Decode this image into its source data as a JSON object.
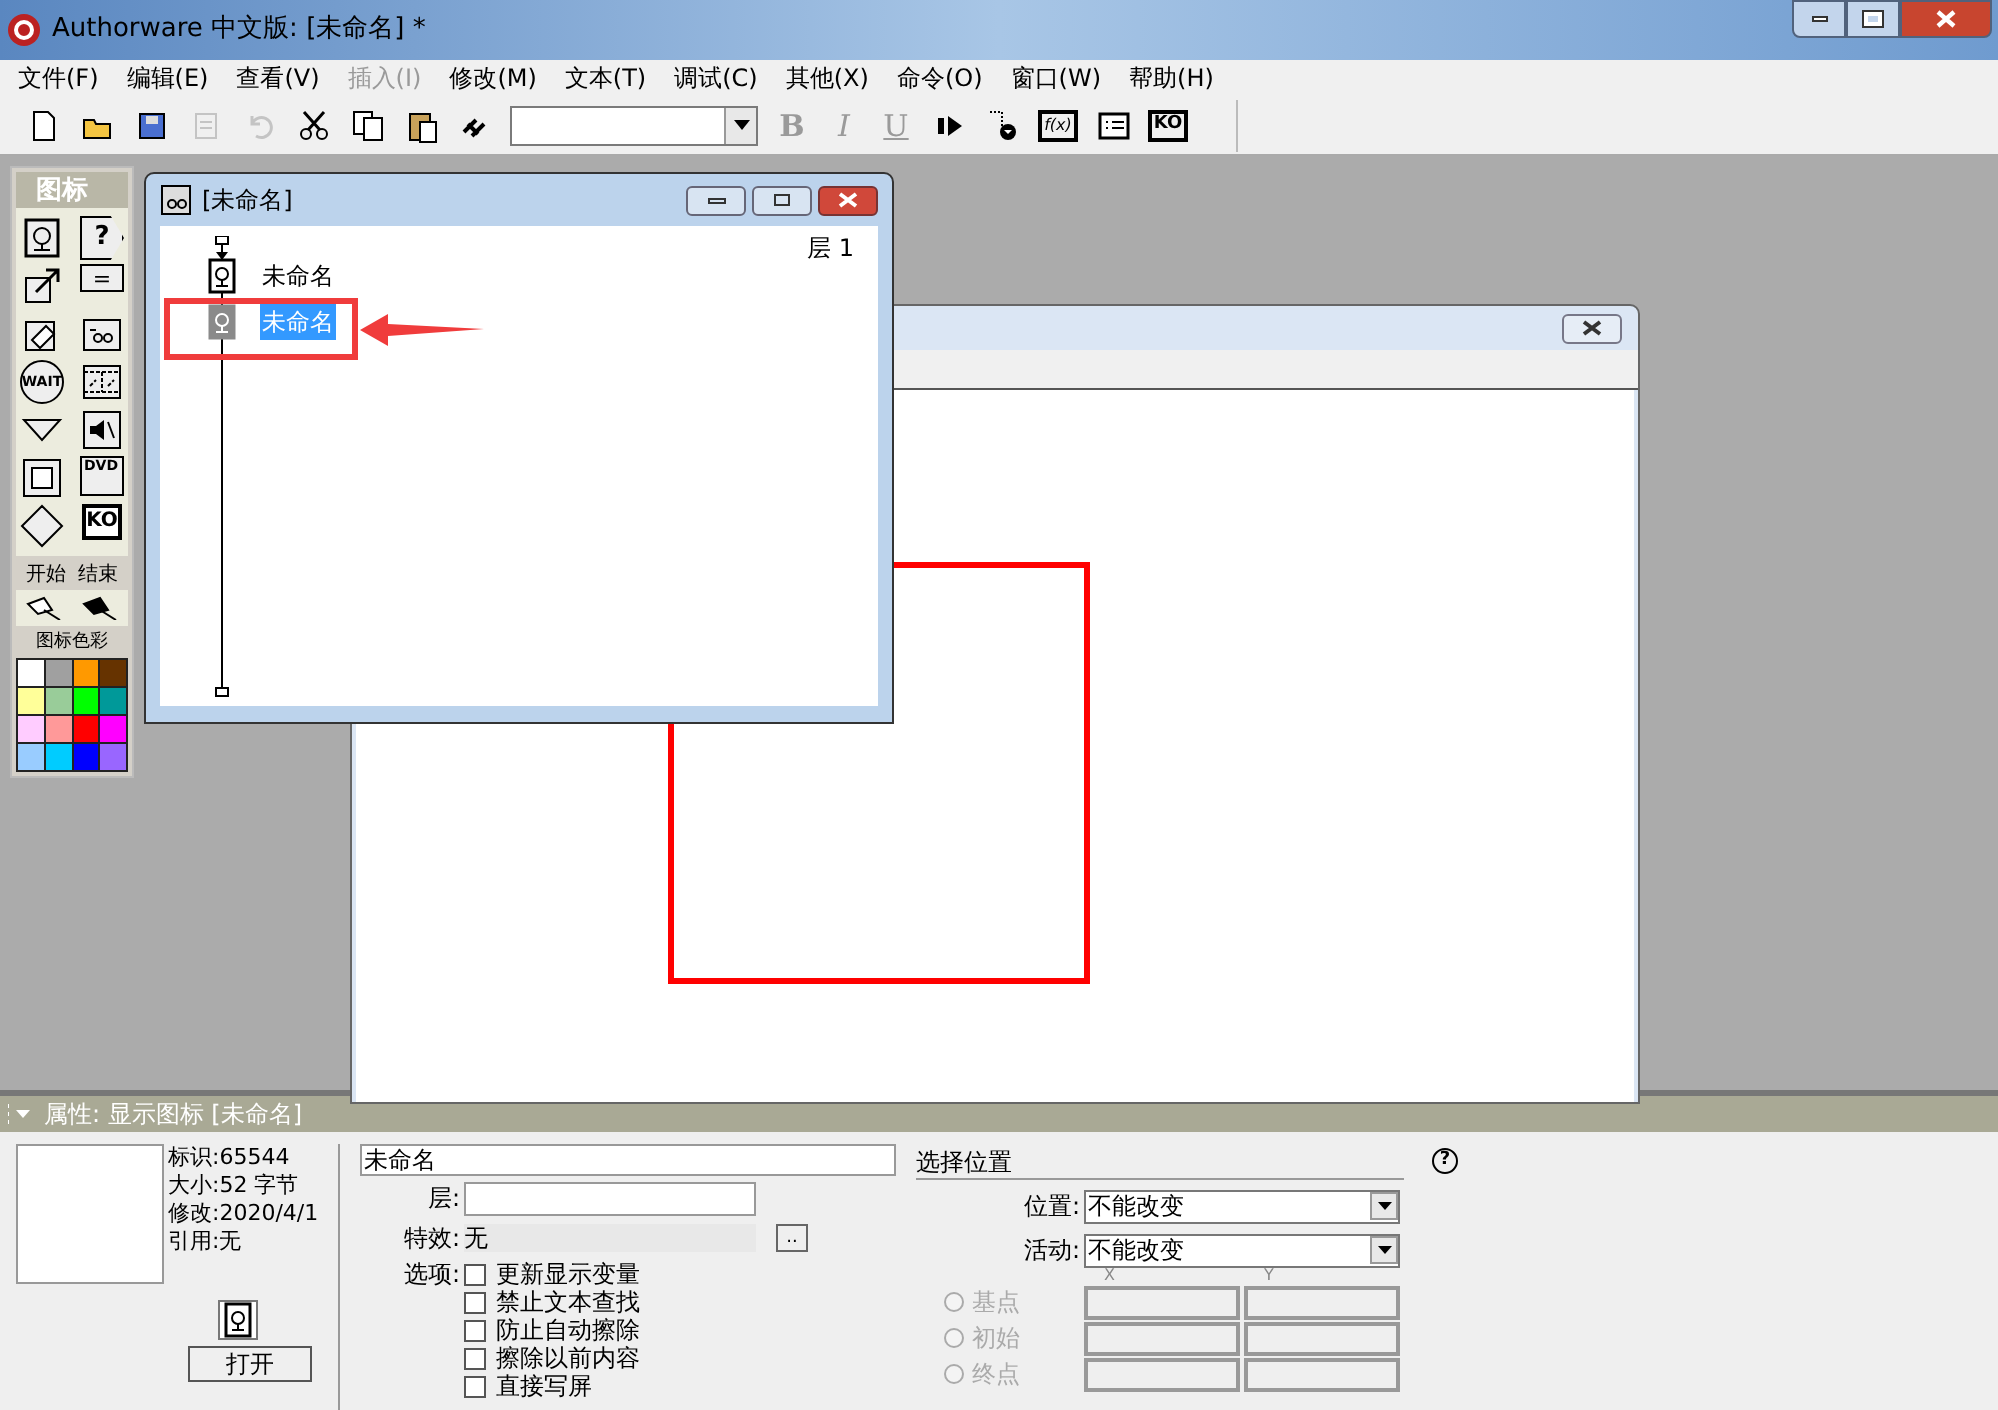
{
  "window": {
    "title": "Authorware 中文版: [未命名] *"
  },
  "menu": [
    {
      "label": "文件(F)",
      "disabled": false
    },
    {
      "label": "编辑(E)",
      "disabled": false
    },
    {
      "label": "查看(V)",
      "disabled": false
    },
    {
      "label": "插入(I)",
      "disabled": true
    },
    {
      "label": "修改(M)",
      "disabled": false
    },
    {
      "label": "文本(T)",
      "disabled": false
    },
    {
      "label": "调试(C)",
      "disabled": false
    },
    {
      "label": "其他(X)",
      "disabled": false
    },
    {
      "label": "命令(O)",
      "disabled": false
    },
    {
      "label": "窗口(W)",
      "disabled": false
    },
    {
      "label": "帮助(H)",
      "disabled": false
    }
  ],
  "toolbar": [
    {
      "kind": "new",
      "disabled": false
    },
    {
      "kind": "open",
      "disabled": false
    },
    {
      "kind": "save",
      "disabled": false
    },
    {
      "kind": "import",
      "disabled": true
    },
    {
      "kind": "undo",
      "disabled": true
    },
    {
      "kind": "cut",
      "disabled": false
    },
    {
      "kind": "copy",
      "disabled": false
    },
    {
      "kind": "paste",
      "disabled": false
    },
    {
      "kind": "find",
      "disabled": false
    },
    {
      "kind": "dropdown",
      "disabled": false
    },
    {
      "kind": "bold",
      "label": "B",
      "disabled": true
    },
    {
      "kind": "italic",
      "label": "I",
      "disabled": true
    },
    {
      "kind": "underline",
      "label": "U",
      "disabled": true
    },
    {
      "kind": "restart",
      "disabled": false
    },
    {
      "kind": "trace",
      "disabled": false
    },
    {
      "kind": "functions",
      "label": "f(x)",
      "disabled": false
    },
    {
      "kind": "variables",
      "disabled": false
    },
    {
      "kind": "knowledge",
      "label": "KO",
      "disabled": false
    }
  ],
  "palette": {
    "title": "图标",
    "tools": [
      {
        "kind": "display"
      },
      {
        "kind": "interaction",
        "label": "?"
      },
      {
        "kind": "motion"
      },
      {
        "kind": "calculation",
        "label": "="
      },
      {
        "kind": "erase"
      },
      {
        "kind": "map"
      },
      {
        "kind": "wait",
        "label": "WAIT"
      },
      {
        "kind": "movie"
      },
      {
        "kind": "navigate"
      },
      {
        "kind": "sound"
      },
      {
        "kind": "framework"
      },
      {
        "kind": "dvd",
        "label": "DVD"
      },
      {
        "kind": "decision"
      },
      {
        "kind": "knowledge",
        "label": "KO"
      }
    ],
    "flags_label": "开始  结束",
    "colors_title": "图标色彩",
    "colors": [
      {
        "color": "#ffffff"
      },
      {
        "color": "#a0a0a0"
      },
      {
        "color": "#ff9900"
      },
      {
        "color": "#663300"
      },
      {
        "color": "#ffff99"
      },
      {
        "color": "#99cc99"
      },
      {
        "color": "#00ff00"
      },
      {
        "color": "#009999"
      },
      {
        "color": "#ffccff"
      },
      {
        "color": "#ff9999"
      },
      {
        "color": "#ff0000"
      },
      {
        "color": "#ff00ff"
      },
      {
        "color": "#99ccff"
      },
      {
        "color": "#00ccff"
      },
      {
        "color": "#0000ff"
      },
      {
        "color": "#9966ff"
      }
    ]
  },
  "flow_window": {
    "title": "[未命名]",
    "level": "层 1",
    "icons": [
      {
        "label": "未命名",
        "selected": false
      },
      {
        "label": "未命名",
        "selected": true
      }
    ]
  },
  "properties": {
    "title": "属性: 显示图标 [未命名]",
    "info": [
      "标识:65544",
      "大小:52 字节",
      "修改:2020/4/1",
      "引用:无"
    ],
    "open_button": "打开",
    "name_value": "未命名",
    "layer_label": "层:",
    "effect_label": "特效:",
    "effect_value": "无",
    "effect_button": "..",
    "options_label": "选项:",
    "options": [
      {
        "label": "更新显示变量",
        "checked": false
      },
      {
        "label": "禁止文本查找",
        "checked": false
      },
      {
        "label": "防止自动擦除",
        "checked": false
      },
      {
        "label": "擦除以前内容",
        "checked": false
      },
      {
        "label": "直接写屏",
        "checked": false
      }
    ],
    "position_title": "选择位置",
    "selects": [
      {
        "label": "位置:",
        "value": "不能改变"
      },
      {
        "label": "活动:",
        "value": "不能改变"
      }
    ],
    "x_label": "X",
    "y_label": "Y",
    "points": [
      {
        "label": "基点",
        "selected": false,
        "disabled": true
      },
      {
        "label": "初始",
        "selected": false,
        "disabled": true
      },
      {
        "label": "终点",
        "selected": false,
        "disabled": true
      }
    ],
    "help": "?"
  }
}
